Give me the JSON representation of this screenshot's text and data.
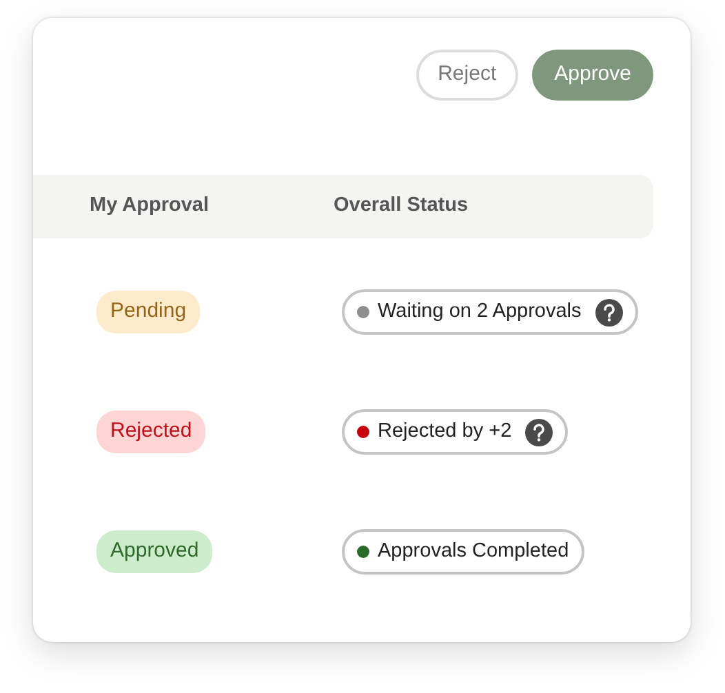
{
  "actions": [
    {
      "label": "Reject",
      "kind": "secondary"
    },
    {
      "label": "Approve",
      "kind": "primary"
    }
  ],
  "table": {
    "columns": [
      "My Approval",
      "Overall Status"
    ],
    "rows": [
      {
        "my_approval": {
          "label": "Pending",
          "kind": "pending"
        },
        "overall_status": {
          "label": "Waiting on 2 Approvals",
          "color": "#8e8e8e",
          "help": true
        }
      },
      {
        "my_approval": {
          "label": "Rejected",
          "kind": "rejected"
        },
        "overall_status": {
          "label": "Rejected by +2",
          "color": "#c8000c",
          "help": true
        }
      },
      {
        "my_approval": {
          "label": "Approved",
          "kind": "approved"
        },
        "overall_status": {
          "label": "Approvals Completed",
          "color": "#2a6b2a",
          "help": false
        }
      }
    ]
  }
}
